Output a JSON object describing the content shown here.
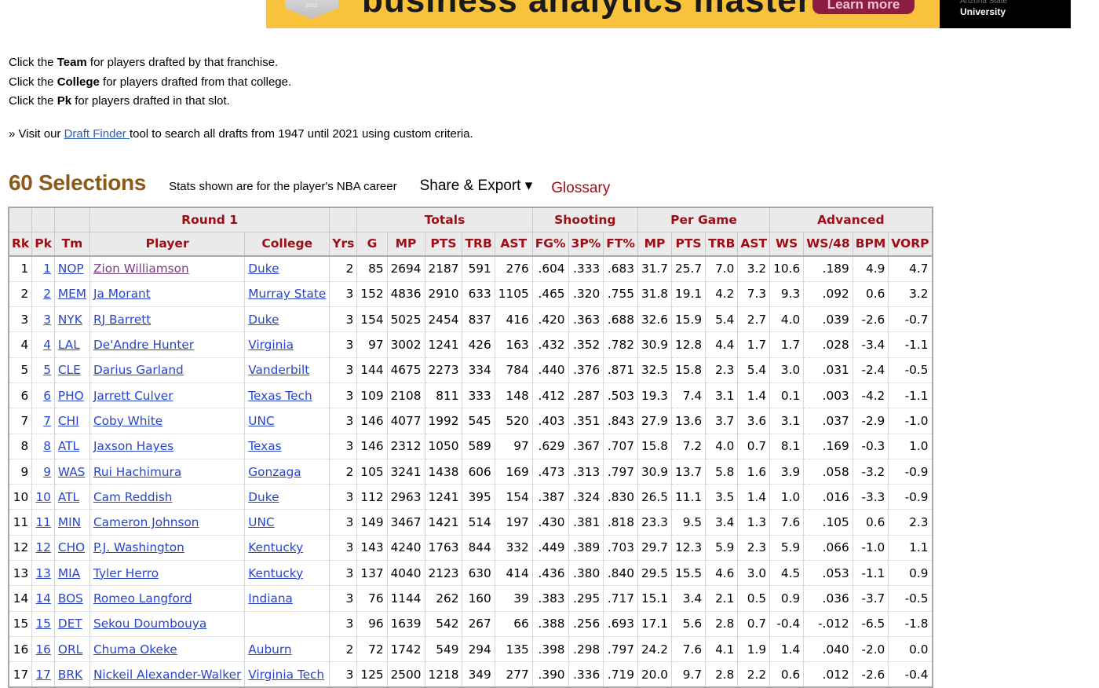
{
  "ad": {
    "badge_text": "2022",
    "headline": "business analytics masters.",
    "cta_label": "Learn more",
    "brand_line1": "Arizona State",
    "brand_line2": "University"
  },
  "instructions": [
    {
      "prefix": "Click the ",
      "bold": "Team",
      "suffix": " for players drafted by that franchise."
    },
    {
      "prefix": "Click the ",
      "bold": "College",
      "suffix": " for players drafted from that college."
    },
    {
      "prefix": "Click the ",
      "bold": "Pk",
      "suffix": " for players drafted in that slot."
    }
  ],
  "finder": {
    "prefix": "» Visit our ",
    "link": "Draft Finder ",
    "suffix": "tool to search all drafts from 1947 until 2021 using custom criteria."
  },
  "section": {
    "title": "60 Selections",
    "note": "Stats shown are for the player's NBA career",
    "share_label": "Share & Export ▾",
    "glossary_label": "Glossary"
  },
  "table": {
    "groups": [
      {
        "label": "",
        "span": 3
      },
      {
        "label": "Round 1",
        "span": 2
      },
      {
        "label": "",
        "span": 1
      },
      {
        "label": "Totals",
        "span": 5
      },
      {
        "label": "Shooting",
        "span": 3
      },
      {
        "label": "Per Game",
        "span": 4
      },
      {
        "label": "Advanced",
        "span": 4
      }
    ],
    "columns": [
      "Rk",
      "Pk",
      "Tm",
      "Player",
      "College",
      "Yrs",
      "G",
      "MP",
      "PTS",
      "TRB",
      "AST",
      "FG%",
      "3P%",
      "FT%",
      "MP",
      "PTS",
      "TRB",
      "AST",
      "WS",
      "WS/48",
      "BPM",
      "VORP"
    ],
    "rows": [
      [
        "1",
        "1",
        "NOP",
        "Zion Williamson",
        "Duke",
        "2",
        "85",
        "2694",
        "2187",
        "591",
        "276",
        ".604",
        ".333",
        ".683",
        "31.7",
        "25.7",
        "7.0",
        "3.2",
        "10.6",
        ".189",
        "4.9",
        "4.7"
      ],
      [
        "2",
        "2",
        "MEM",
        "Ja Morant",
        "Murray State",
        "3",
        "152",
        "4836",
        "2910",
        "633",
        "1105",
        ".465",
        ".320",
        ".755",
        "31.8",
        "19.1",
        "4.2",
        "7.3",
        "9.3",
        ".092",
        "0.6",
        "3.2"
      ],
      [
        "3",
        "3",
        "NYK",
        "RJ Barrett",
        "Duke",
        "3",
        "154",
        "5025",
        "2454",
        "837",
        "416",
        ".420",
        ".363",
        ".688",
        "32.6",
        "15.9",
        "5.4",
        "2.7",
        "4.0",
        ".039",
        "-2.6",
        "-0.7"
      ],
      [
        "4",
        "4",
        "LAL",
        "De'Andre Hunter",
        "Virginia",
        "3",
        "97",
        "3002",
        "1241",
        "426",
        "163",
        ".432",
        ".352",
        ".782",
        "30.9",
        "12.8",
        "4.4",
        "1.7",
        "1.7",
        ".028",
        "-3.4",
        "-1.1"
      ],
      [
        "5",
        "5",
        "CLE",
        "Darius Garland",
        "Vanderbilt",
        "3",
        "144",
        "4675",
        "2273",
        "334",
        "784",
        ".440",
        ".376",
        ".871",
        "32.5",
        "15.8",
        "2.3",
        "5.4",
        "3.0",
        ".031",
        "-2.4",
        "-0.5"
      ],
      [
        "6",
        "6",
        "PHO",
        "Jarrett Culver",
        "Texas Tech",
        "3",
        "109",
        "2108",
        "811",
        "333",
        "148",
        ".412",
        ".287",
        ".503",
        "19.3",
        "7.4",
        "3.1",
        "1.4",
        "0.1",
        ".003",
        "-4.2",
        "-1.1"
      ],
      [
        "7",
        "7",
        "CHI",
        "Coby White",
        "UNC",
        "3",
        "146",
        "4077",
        "1992",
        "545",
        "520",
        ".403",
        ".351",
        ".843",
        "27.9",
        "13.6",
        "3.7",
        "3.6",
        "3.1",
        ".037",
        "-2.9",
        "-1.0"
      ],
      [
        "8",
        "8",
        "ATL",
        "Jaxson Hayes",
        "Texas",
        "3",
        "146",
        "2312",
        "1050",
        "589",
        "97",
        ".629",
        ".367",
        ".707",
        "15.8",
        "7.2",
        "4.0",
        "0.7",
        "8.1",
        ".169",
        "-0.3",
        "1.0"
      ],
      [
        "9",
        "9",
        "WAS",
        "Rui Hachimura",
        "Gonzaga",
        "2",
        "105",
        "3241",
        "1438",
        "606",
        "169",
        ".473",
        ".313",
        ".797",
        "30.9",
        "13.7",
        "5.8",
        "1.6",
        "3.9",
        ".058",
        "-3.2",
        "-0.9"
      ],
      [
        "10",
        "10",
        "ATL",
        "Cam Reddish",
        "Duke",
        "3",
        "112",
        "2963",
        "1241",
        "395",
        "154",
        ".387",
        ".324",
        ".830",
        "26.5",
        "11.1",
        "3.5",
        "1.4",
        "1.0",
        ".016",
        "-3.3",
        "-0.9"
      ],
      [
        "11",
        "11",
        "MIN",
        "Cameron Johnson",
        "UNC",
        "3",
        "149",
        "3467",
        "1421",
        "514",
        "197",
        ".430",
        ".381",
        ".818",
        "23.3",
        "9.5",
        "3.4",
        "1.3",
        "7.6",
        ".105",
        "0.6",
        "2.3"
      ],
      [
        "12",
        "12",
        "CHO",
        "P.J. Washington",
        "Kentucky",
        "3",
        "143",
        "4240",
        "1763",
        "844",
        "332",
        ".449",
        ".389",
        ".703",
        "29.7",
        "12.3",
        "5.9",
        "2.3",
        "5.9",
        ".066",
        "-1.0",
        "1.1"
      ],
      [
        "13",
        "13",
        "MIA",
        "Tyler Herro",
        "Kentucky",
        "3",
        "137",
        "4040",
        "2123",
        "630",
        "414",
        ".436",
        ".380",
        ".840",
        "29.5",
        "15.5",
        "4.6",
        "3.0",
        "4.5",
        ".053",
        "-1.1",
        "0.9"
      ],
      [
        "14",
        "14",
        "BOS",
        "Romeo Langford",
        "Indiana",
        "3",
        "76",
        "1144",
        "262",
        "160",
        "39",
        ".383",
        ".295",
        ".717",
        "15.1",
        "3.4",
        "2.1",
        "0.5",
        "0.9",
        ".036",
        "-3.7",
        "-0.5"
      ],
      [
        "15",
        "15",
        "DET",
        "Sekou Doumbouya",
        "",
        "3",
        "96",
        "1639",
        "542",
        "267",
        "66",
        ".388",
        ".256",
        ".693",
        "17.1",
        "5.6",
        "2.8",
        "0.7",
        "-0.4",
        "-.012",
        "-6.5",
        "-1.8"
      ],
      [
        "16",
        "16",
        "ORL",
        "Chuma Okeke",
        "Auburn",
        "2",
        "72",
        "1742",
        "549",
        "294",
        "135",
        ".398",
        ".298",
        ".797",
        "24.2",
        "7.6",
        "4.1",
        "1.9",
        "1.4",
        ".040",
        "-2.0",
        "0.0"
      ],
      [
        "17",
        "17",
        "BRK",
        "Nickeil Alexander-Walker",
        "Virginia Tech",
        "3",
        "125",
        "2500",
        "1218",
        "349",
        "277",
        ".390",
        ".336",
        ".719",
        "20.0",
        "9.7",
        "2.8",
        "2.2",
        "0.6",
        ".012",
        "-2.6",
        "-0.4"
      ]
    ],
    "visited_player_rows": [
      0
    ]
  },
  "colors": {
    "title_brown": "#8b5a16",
    "header_red": "#9c0d16",
    "link_blue": "#2945c9",
    "visited_purple": "#7a3c80",
    "ad_gold": "#f9c23c",
    "ad_maroon": "#8c1d40"
  }
}
